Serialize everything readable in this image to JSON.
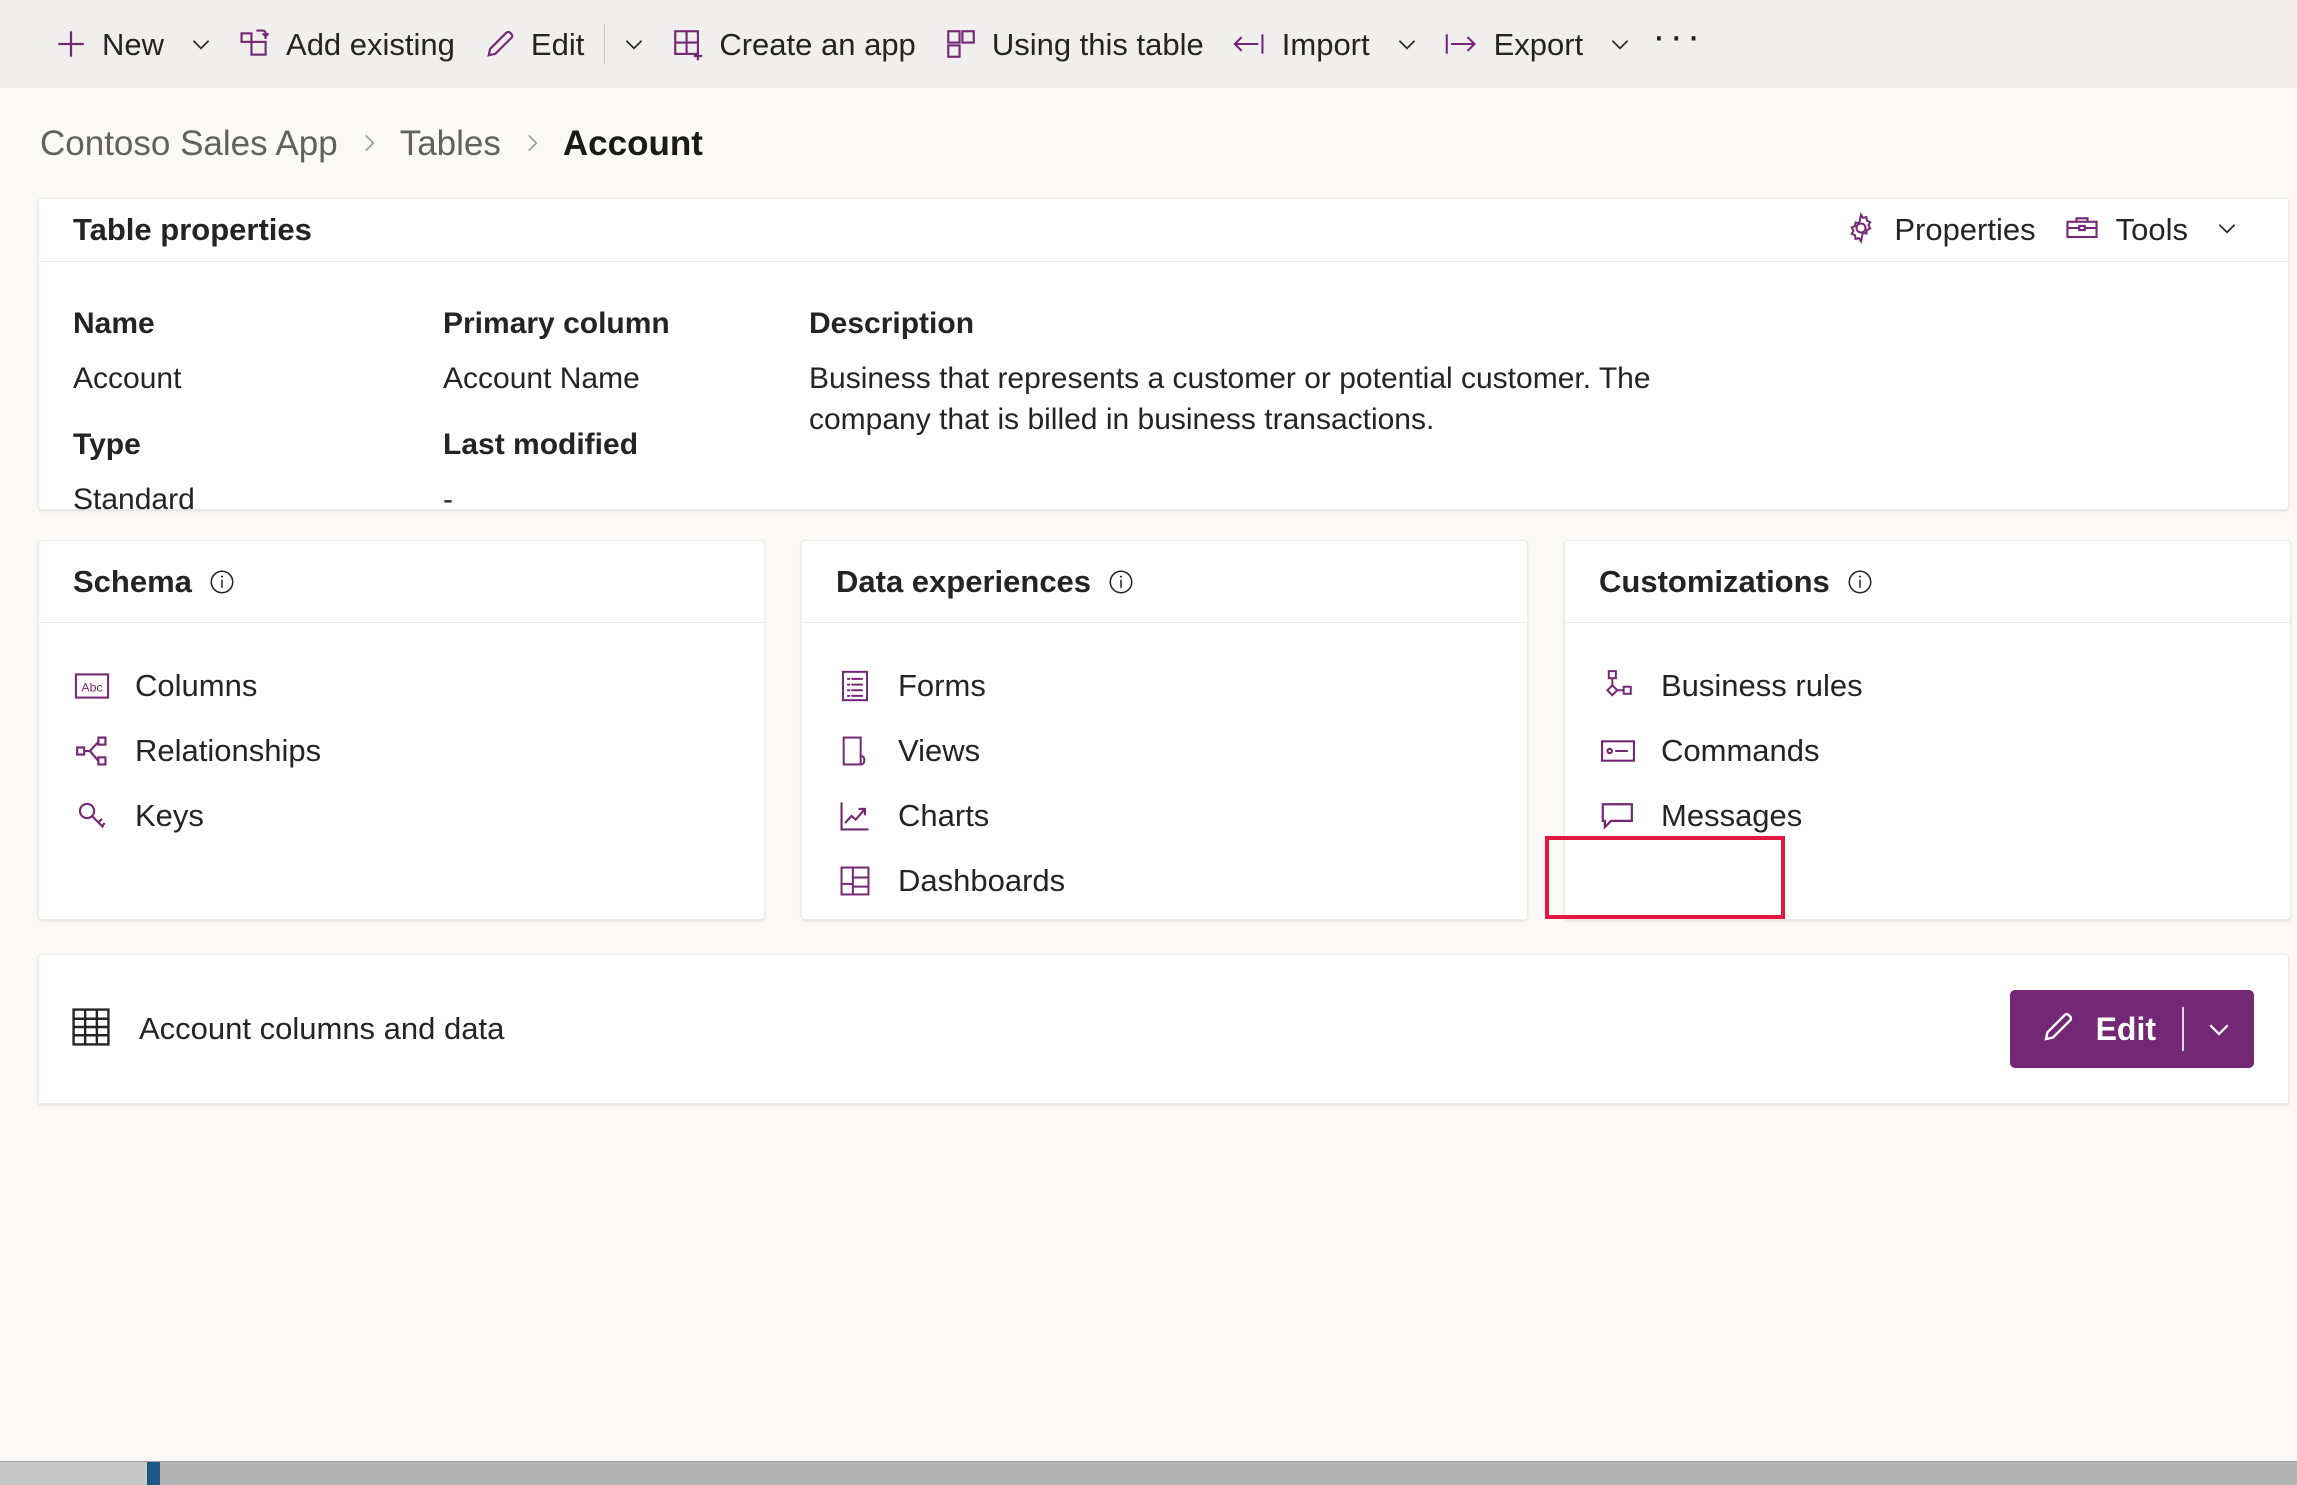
{
  "colors": {
    "accent": "#742774",
    "highlight": "#e3173e",
    "toolbar_bg": "#f0efee",
    "page_bg": "#faf9f8",
    "card_bg": "#ffffff",
    "text": "#242424",
    "muted_text": "#616161"
  },
  "commandbar": {
    "items": [
      {
        "label": "New",
        "icon": "plus-icon",
        "caret": true
      },
      {
        "label": "Add existing",
        "icon": "add-existing-icon",
        "caret": false
      },
      {
        "label": "Edit",
        "icon": "pencil-icon",
        "caret": true,
        "divider_before_caret": true
      },
      {
        "label": "Create an app",
        "icon": "create-app-icon",
        "caret": false
      },
      {
        "label": "Using this table",
        "icon": "using-this-table-icon",
        "caret": false
      },
      {
        "label": "Import",
        "icon": "import-icon",
        "caret": true
      },
      {
        "label": "Export",
        "icon": "export-icon",
        "caret": true
      }
    ],
    "overflow_label": "···"
  },
  "breadcrumb": {
    "items": [
      {
        "label": "Contoso Sales App",
        "current": false
      },
      {
        "label": "Tables",
        "current": false
      },
      {
        "label": "Account",
        "current": true
      }
    ],
    "separator": "chevron-right-icon"
  },
  "table_properties": {
    "title": "Table properties",
    "actions": [
      {
        "label": "Properties",
        "icon": "gear-icon",
        "caret": false
      },
      {
        "label": "Tools",
        "icon": "toolbox-icon",
        "caret": true
      }
    ],
    "fields": {
      "name_label": "Name",
      "name_value": "Account",
      "type_label": "Type",
      "type_value": "Standard",
      "primary_column_label": "Primary column",
      "primary_column_value": "Account Name",
      "last_modified_label": "Last modified",
      "last_modified_value": "-",
      "description_label": "Description",
      "description_value": "Business that represents a customer or potential customer. The company that is billed in business transactions."
    }
  },
  "cards": [
    {
      "title": "Schema",
      "info_icon": "info-icon",
      "links": [
        {
          "label": "Columns",
          "icon": "abc-icon"
        },
        {
          "label": "Relationships",
          "icon": "relationships-icon"
        },
        {
          "label": "Keys",
          "icon": "key-icon"
        }
      ]
    },
    {
      "title": "Data experiences",
      "info_icon": "info-icon",
      "links": [
        {
          "label": "Forms",
          "icon": "form-icon"
        },
        {
          "label": "Views",
          "icon": "view-icon"
        },
        {
          "label": "Charts",
          "icon": "chart-icon"
        },
        {
          "label": "Dashboards",
          "icon": "dashboard-icon"
        }
      ]
    },
    {
      "title": "Customizations",
      "info_icon": "info-icon",
      "links": [
        {
          "label": "Business rules",
          "icon": "business-rules-icon"
        },
        {
          "label": "Commands",
          "icon": "commands-icon"
        },
        {
          "label": "Messages",
          "icon": "messages-icon",
          "highlighted": true
        }
      ]
    }
  ],
  "grid_section": {
    "title": "Account columns and data",
    "icon": "table-grid-icon",
    "edit_button_label": "Edit",
    "edit_button_icon": "pencil-icon",
    "edit_button_caret": "chevron-down-icon"
  }
}
